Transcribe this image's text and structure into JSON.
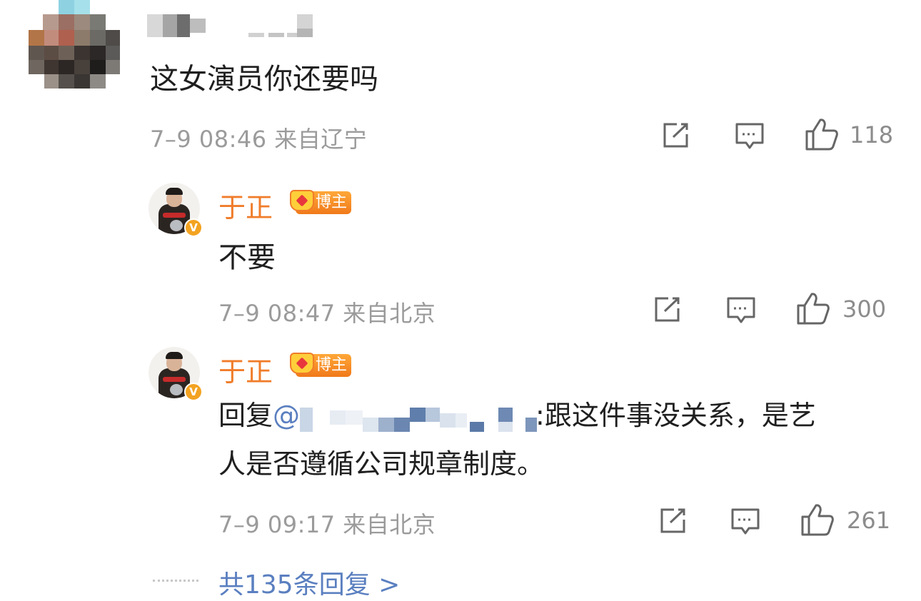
{
  "comments": [
    {
      "text": "这女演员你还要吗",
      "time": "7–9 08:46",
      "location": "来自辽宁",
      "likes": "118"
    }
  ],
  "replies": [
    {
      "username": "于正",
      "badge": "博主",
      "verified": "V",
      "text": "不要",
      "time": "7–9 08:47",
      "location": "来自北京",
      "likes": "300"
    },
    {
      "username": "于正",
      "badge": "博主",
      "verified": "V",
      "reply_prefix": "回复",
      "at_sign": "@",
      "text_line1": ":跟这件事没关系，是艺",
      "text_line2": "人是否遵循公司规章制度。",
      "time": "7–9 09:17",
      "location": "来自北京",
      "likes": "261"
    }
  ],
  "more_replies": "共135条回复 >",
  "icons": [
    "share-icon",
    "comment-icon",
    "like-icon"
  ],
  "colors": {
    "username": "#f07c2a",
    "link": "#5a7fc0",
    "meta": "#9b9b9b",
    "badge": "#f0791a"
  }
}
